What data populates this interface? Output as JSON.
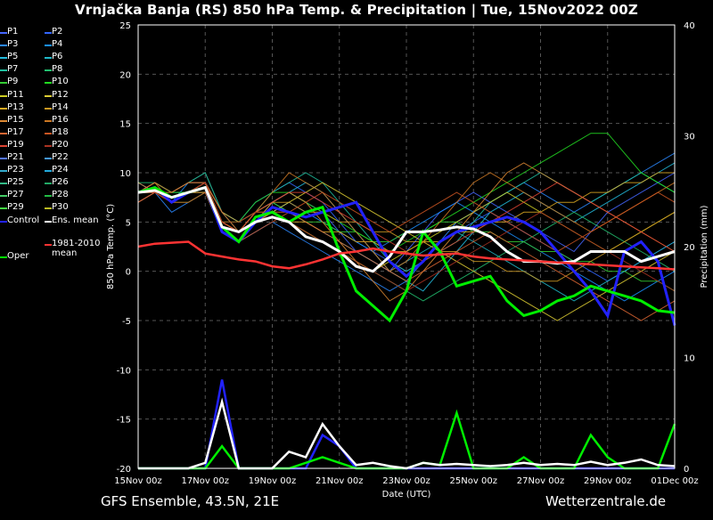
{
  "title": "Vrnjačka Banja  (RS)  850 hPa Temp. & Precipitation | Tue, 15Nov2022 00Z",
  "footer": {
    "left": "GFS Ensemble, 43.5N, 21E",
    "right": "Wetterzentrale.de"
  },
  "legend": [
    {
      "label": "P1",
      "color": "#4466ff"
    },
    {
      "label": "P2",
      "color": "#3366ff"
    },
    {
      "label": "P3",
      "color": "#2a88ff"
    },
    {
      "label": "P4",
      "color": "#1a8fff"
    },
    {
      "label": "P5",
      "color": "#22bbdd"
    },
    {
      "label": "P6",
      "color": "#1fb8c8"
    },
    {
      "label": "P7",
      "color": "#20c0a0"
    },
    {
      "label": "P8",
      "color": "#22c070"
    },
    {
      "label": "P9",
      "color": "#33cc33"
    },
    {
      "label": "P10",
      "color": "#22dd22"
    },
    {
      "label": "P11",
      "color": "#cccc22"
    },
    {
      "label": "P12",
      "color": "#ddcc33"
    },
    {
      "label": "P13",
      "color": "#ddaa22"
    },
    {
      "label": "P14",
      "color": "#cc9922"
    },
    {
      "label": "P15",
      "color": "#dd8833"
    },
    {
      "label": "P16",
      "color": "#cc7722"
    },
    {
      "label": "P17",
      "color": "#dd6633"
    },
    {
      "label": "P18",
      "color": "#cc5522"
    },
    {
      "label": "P19",
      "color": "#dd4433"
    },
    {
      "label": "P20",
      "color": "#aa3322"
    },
    {
      "label": "P21",
      "color": "#5577ff"
    },
    {
      "label": "P22",
      "color": "#4499ee"
    },
    {
      "label": "P23",
      "color": "#33aacc"
    },
    {
      "label": "P24",
      "color": "#22aadd"
    },
    {
      "label": "P25",
      "color": "#33bb88"
    },
    {
      "label": "P26",
      "color": "#22aa66"
    },
    {
      "label": "P27",
      "color": "#44cc66"
    },
    {
      "label": "P28",
      "color": "#22bb44"
    },
    {
      "label": "P29",
      "color": "#44dd44"
    },
    {
      "label": "P30",
      "color": "#bbbb22"
    },
    {
      "label": "Control",
      "color": "#2222ff"
    },
    {
      "label": "Ens. mean",
      "color": "#ffffff"
    },
    {
      "label": "1981-2010\nmean",
      "color": "#ff3333"
    },
    {
      "label": "Oper",
      "color": "#00ee00"
    }
  ],
  "chart_data": {
    "type": "line",
    "title": "Vrnjačka Banja  (RS)  850 hPa Temp. & Precipitation | Tue, 15Nov2022 00Z",
    "xlabel": "Date (UTC)",
    "ylabel": "850 hPa Temp. (°C)",
    "y2label": "Precipitation (mm)",
    "xticks": [
      "15Nov 00z",
      "17Nov 00z",
      "19Nov 00z",
      "21Nov 00z",
      "23Nov 00z",
      "25Nov 00z",
      "27Nov 00z",
      "29Nov 00z",
      "01Dec 00z"
    ],
    "ylim": [
      -20,
      25
    ],
    "y2lim": [
      0,
      40
    ],
    "yticks": [
      25,
      20,
      15,
      10,
      5,
      0,
      -5,
      -10,
      -15,
      -20
    ],
    "y2ticks": [
      40,
      30,
      20,
      10,
      0
    ],
    "x_hours": [
      0,
      12,
      24,
      36,
      48,
      60,
      72,
      84,
      96,
      108,
      120,
      132,
      144,
      156,
      168,
      180,
      192,
      204,
      216,
      228,
      240,
      252,
      264,
      276,
      288,
      300,
      312,
      324,
      336,
      348,
      360,
      372,
      384
    ],
    "grid": true,
    "series": [
      {
        "name": "Control",
        "color": "#2222ff",
        "width": 3,
        "values": [
          8,
          8.5,
          7,
          8,
          8.5,
          4,
          3,
          5,
          6.5,
          6,
          5.5,
          6,
          6.5,
          7,
          4,
          1,
          -0.5,
          1,
          3,
          4,
          4.5,
          5,
          5.5,
          5,
          4,
          2,
          0,
          -2,
          -4.5,
          2,
          3,
          1,
          -5.5
        ]
      },
      {
        "name": "Oper",
        "color": "#00ee00",
        "width": 3,
        "values": [
          8,
          8.5,
          7.5,
          8,
          8.5,
          4.5,
          3,
          5.5,
          6,
          5,
          6,
          6.5,
          2,
          -2,
          -3.5,
          -5,
          -2,
          4,
          2,
          -1.5,
          -1,
          -0.5,
          -3,
          -4.5,
          -4,
          -3,
          -2.5,
          -1.5,
          -2,
          -2.5,
          -3,
          -4,
          -4.2
        ]
      },
      {
        "name": "Ens. mean",
        "color": "#ffffff",
        "width": 3,
        "values": [
          8,
          8.2,
          7.5,
          8,
          8.5,
          4.5,
          4,
          5,
          5.5,
          5,
          3.5,
          3,
          2,
          0.5,
          0,
          1.5,
          4,
          4,
          4.2,
          4.5,
          4.3,
          3.5,
          2,
          1,
          1,
          0.8,
          1,
          2,
          2,
          2,
          1,
          1.5,
          2
        ]
      },
      {
        "name": "1981-2010\nmean",
        "color": "#ff3333",
        "width": 2.5,
        "values": [
          2.5,
          2.8,
          2.9,
          3,
          1.8,
          1.5,
          1.2,
          1,
          0.5,
          0.3,
          0.7,
          1.2,
          1.8,
          2,
          2.3,
          2,
          1.8,
          1.6,
          1.7,
          1.8,
          1.5,
          1.3,
          1.2,
          1.1,
          1,
          0.9,
          0.8,
          0.7,
          0.6,
          0.5,
          0.4,
          0.3,
          0.2
        ]
      }
    ],
    "members_temp": [
      [
        8,
        8,
        7,
        8,
        9,
        5,
        4,
        6,
        7,
        8,
        7,
        6,
        4,
        2,
        1,
        0,
        2,
        4,
        6,
        7,
        8,
        7,
        6,
        5,
        4,
        3,
        2,
        4,
        6,
        7,
        8,
        9,
        10
      ],
      [
        8,
        9,
        8,
        9,
        10,
        6,
        5,
        7,
        8,
        9,
        8,
        7,
        5,
        3,
        2,
        1,
        0,
        1,
        3,
        4,
        5,
        6,
        5,
        4,
        3,
        2,
        1,
        0,
        -1,
        0,
        1,
        2,
        3
      ],
      [
        8,
        8,
        6,
        7,
        8,
        4,
        3,
        4,
        5,
        4,
        3,
        2,
        1,
        0,
        -1,
        -2,
        -1,
        1,
        3,
        5,
        6,
        7,
        8,
        9,
        8,
        7,
        6,
        7,
        8,
        9,
        10,
        11,
        12
      ],
      [
        9,
        8,
        7,
        9,
        9,
        5,
        4,
        5,
        6,
        7,
        6,
        5,
        4,
        3,
        2,
        3,
        4,
        5,
        6,
        7,
        6,
        5,
        4,
        3,
        2,
        1,
        0,
        -1,
        -2,
        -3,
        -2,
        -1,
        0
      ],
      [
        7,
        8,
        7,
        8,
        8,
        4,
        3,
        5,
        7,
        8,
        9,
        8,
        6,
        4,
        2,
        0,
        -1,
        -2,
        0,
        2,
        4,
        6,
        7,
        8,
        7,
        6,
        5,
        6,
        7,
        8,
        9,
        10,
        11
      ],
      [
        8,
        9,
        8,
        8,
        9,
        6,
        5,
        6,
        7,
        6,
        5,
        4,
        3,
        2,
        1,
        0,
        1,
        2,
        3,
        4,
        3,
        2,
        1,
        0,
        -1,
        -2,
        -3,
        -2,
        -1,
        0,
        1,
        2,
        3
      ],
      [
        8,
        8,
        7,
        8,
        9,
        5,
        4,
        6,
        8,
        9,
        10,
        9,
        7,
        5,
        3,
        1,
        0,
        1,
        2,
        3,
        5,
        7,
        8,
        9,
        10,
        9,
        8,
        7,
        8,
        9,
        10,
        9,
        8
      ],
      [
        9,
        9,
        8,
        9,
        10,
        6,
        4,
        5,
        6,
        5,
        4,
        3,
        2,
        1,
        0,
        -1,
        -2,
        -3,
        -2,
        -1,
        0,
        1,
        2,
        3,
        4,
        5,
        6,
        5,
        4,
        3,
        2,
        1,
        0
      ],
      [
        8,
        8,
        7,
        7,
        8,
        5,
        4,
        6,
        7,
        6,
        5,
        5,
        4,
        4,
        3,
        3,
        4,
        4,
        5,
        5,
        4,
        4,
        3,
        3,
        2,
        2,
        1,
        1,
        0,
        0,
        -1,
        -1,
        -2
      ],
      [
        8,
        9,
        8,
        8,
        9,
        5,
        5,
        7,
        8,
        8,
        7,
        6,
        5,
        4,
        3,
        2,
        3,
        4,
        5,
        6,
        7,
        8,
        9,
        10,
        11,
        12,
        13,
        14,
        14,
        12,
        10,
        9,
        8
      ],
      [
        8,
        8,
        7,
        8,
        8,
        4,
        3,
        5,
        6,
        5,
        4,
        3,
        2,
        1,
        0,
        1,
        2,
        3,
        4,
        5,
        6,
        7,
        8,
        7,
        6,
        5,
        4,
        3,
        2,
        3,
        4,
        5,
        6
      ],
      [
        7,
        8,
        7,
        8,
        9,
        5,
        4,
        5,
        6,
        7,
        8,
        9,
        8,
        7,
        6,
        5,
        4,
        3,
        2,
        1,
        0,
        -1,
        -2,
        -3,
        -4,
        -5,
        -4,
        -3,
        -2,
        -1,
        0,
        1,
        2
      ],
      [
        8,
        8,
        8,
        9,
        9,
        6,
        5,
        6,
        6,
        5,
        5,
        4,
        4,
        3,
        3,
        2,
        2,
        3,
        3,
        4,
        4,
        5,
        5,
        6,
        6,
        7,
        7,
        8,
        8,
        9,
        9,
        10,
        10
      ],
      [
        8,
        9,
        7,
        8,
        9,
        5,
        4,
        6,
        7,
        7,
        6,
        6,
        5,
        5,
        4,
        4,
        3,
        3,
        2,
        2,
        1,
        1,
        0,
        0,
        -1,
        -1,
        0,
        1,
        2,
        3,
        4,
        5,
        6
      ],
      [
        9,
        8,
        7,
        8,
        8,
        5,
        4,
        5,
        7,
        8,
        7,
        5,
        3,
        1,
        -1,
        -3,
        -2,
        0,
        2,
        4,
        6,
        8,
        10,
        11,
        10,
        9,
        8,
        7,
        6,
        5,
        4,
        3,
        2
      ],
      [
        8,
        8,
        7,
        8,
        9,
        5,
        4,
        6,
        8,
        10,
        9,
        8,
        6,
        4,
        2,
        0,
        1,
        3,
        5,
        7,
        9,
        10,
        9,
        8,
        7,
        6,
        5,
        4,
        5,
        6,
        7,
        8,
        9
      ],
      [
        8,
        9,
        8,
        9,
        9,
        6,
        4,
        5,
        6,
        6,
        5,
        4,
        3,
        2,
        1,
        0,
        -1,
        0,
        1,
        2,
        3,
        4,
        3,
        2,
        1,
        0,
        -1,
        -2,
        -3,
        -4,
        -5,
        -4,
        -3
      ],
      [
        8,
        8,
        7,
        7,
        8,
        4,
        3,
        4,
        5,
        6,
        7,
        8,
        7,
        6,
        5,
        4,
        5,
        6,
        7,
        8,
        7,
        6,
        5,
        4,
        3,
        2,
        3,
        4,
        5,
        6,
        7,
        8,
        7
      ],
      [
        7,
        8,
        7,
        8,
        9,
        5,
        4,
        6,
        7,
        8,
        8,
        7,
        6,
        5,
        4,
        3,
        2,
        1,
        2,
        3,
        4,
        5,
        6,
        7,
        8,
        9,
        8,
        7,
        6,
        5,
        4,
        3,
        2
      ],
      [
        8,
        8,
        7,
        8,
        9,
        5,
        5,
        6,
        6,
        5,
        4,
        3,
        2,
        1,
        0,
        -1,
        -2,
        -1,
        0,
        1,
        2,
        3,
        4,
        5,
        6,
        5,
        4,
        3,
        2,
        1,
        0,
        -1,
        -2
      ]
    ],
    "precip_mm": {
      "mean": [
        0,
        0,
        0,
        0,
        0.5,
        6,
        0,
        0,
        0,
        1.5,
        1,
        4,
        2,
        0.3,
        0.5,
        0.2,
        0,
        0.5,
        0.3,
        0.4,
        0.3,
        0.2,
        0.3,
        0.5,
        0.3,
        0.4,
        0.3,
        0.6,
        0.3,
        0.5,
        0.8,
        0.3,
        0.2
      ],
      "oper": [
        0,
        0,
        0,
        0,
        0,
        2,
        0,
        0,
        0,
        0,
        0.5,
        1,
        0.5,
        0,
        0,
        0,
        0,
        0.5,
        0.3,
        5,
        0,
        0,
        0,
        1,
        0,
        0,
        0,
        3,
        1,
        0,
        0,
        0,
        4
      ],
      "control": [
        0,
        0,
        0,
        0,
        0,
        8,
        0,
        0,
        0,
        0,
        0,
        3,
        2,
        0,
        0,
        0,
        0,
        0,
        0,
        0,
        0,
        0,
        0,
        0,
        0,
        0,
        0,
        0,
        0,
        0,
        0,
        0,
        0
      ]
    }
  }
}
